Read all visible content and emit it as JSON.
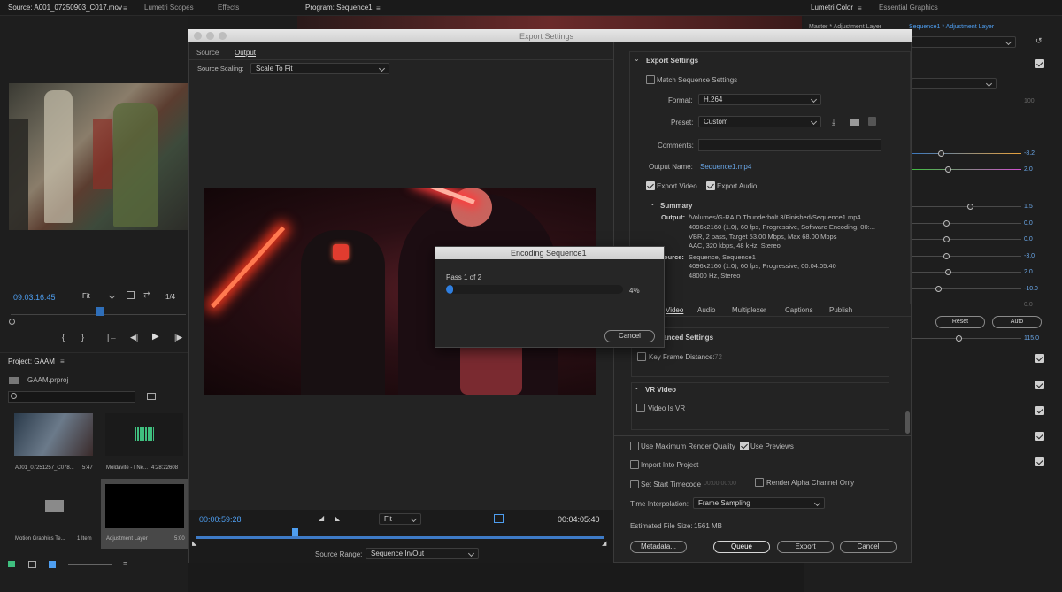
{
  "source_panel": {
    "tab_source": "Source: A001_07250903_C017.mov",
    "tab_scopes": "Lumetri Scopes",
    "tab_effects": "Effects",
    "timecode": "09:03:16:45",
    "fit": "Fit",
    "fraction": "1/4"
  },
  "program_panel": {
    "tab": "Program: Sequence1"
  },
  "lumetri": {
    "tab_color": "Lumetri Color",
    "tab_graphics": "Essential Graphics",
    "master_label": "Master * Adjustment Layer",
    "sequence_label": "Sequence1 * Adjustment Layer",
    "values": [
      "100",
      "-8.2",
      "2.0",
      "1.5",
      "0.0",
      "0.0",
      "-3.0",
      "2.0",
      "-10.0",
      "0.0",
      "115.0"
    ],
    "reset_label": "Reset",
    "auto_label": "Auto"
  },
  "project": {
    "title": "Project: GAAM",
    "file": "GAAM.prproj",
    "items": [
      {
        "name": "A001_07251257_C078...",
        "meta": "5:47"
      },
      {
        "name": "Moldavite - I Ne...",
        "meta": "4:28:22608"
      },
      {
        "name": "Motion Graphics Te...",
        "meta": "1 Item"
      },
      {
        "name": "Adjustment Layer",
        "meta": "5:00"
      }
    ]
  },
  "export_dialog": {
    "title": "Export Settings",
    "tab_source": "Source",
    "tab_output": "Output",
    "source_scaling_label": "Source Scaling:",
    "source_scaling_value": "Scale To Fit",
    "current_time": "00:00:59:28",
    "fit": "Fit",
    "duration": "00:04:05:40",
    "source_range_label": "Source Range:",
    "source_range_value": "Sequence In/Out",
    "section_export": "Export Settings",
    "match_sequence": "Match Sequence Settings",
    "format_label": "Format:",
    "format_value": "H.264",
    "preset_label": "Preset:",
    "preset_value": "Custom",
    "comments_label": "Comments:",
    "output_name_label": "Output Name:",
    "output_name_value": "Sequence1.mp4",
    "export_video": "Export Video",
    "export_audio": "Export Audio",
    "summary_title": "Summary",
    "summary_output_label": "Output:",
    "summary_output_lines": [
      "/Volumes/G-RAID Thunderbolt 3/Finished/Sequence1.mp4",
      "4096x2160 (1.0), 60 fps, Progressive, Software Encoding, 00:...",
      "VBR, 2 pass, Target 53.00 Mbps, Max 68.00 Mbps",
      "AAC, 320 kbps, 48 kHz, Stereo"
    ],
    "summary_source_label": "Source:",
    "summary_source_lines": [
      "Sequence, Sequence1",
      "4096x2160 (1.0), 60 fps, Progressive, 00:04:05:40",
      "48000 Hz, Stereo"
    ],
    "tabs": [
      "Video",
      "Audio",
      "Multiplexer",
      "Captions",
      "Publish"
    ],
    "advanced_settings": "Advanced Settings",
    "key_frame_distance": "Key Frame Distance:",
    "key_frame_value": "72",
    "vr_video_title": "VR Video",
    "video_is_vr": "Video Is VR",
    "max_render_quality": "Use Maximum Render Quality",
    "use_previews": "Use Previews",
    "import_into_project": "Import Into Project",
    "set_start_timecode": "Set Start Timecode",
    "start_timecode_value": "00:00:00:00",
    "render_alpha": "Render Alpha Channel Only",
    "time_interp_label": "Time Interpolation:",
    "time_interp_value": "Frame Sampling",
    "file_size_label": "Estimated File Size:",
    "file_size_value": "1561 MB",
    "metadata_btn": "Metadata...",
    "queue_btn": "Queue",
    "export_btn": "Export",
    "cancel_btn": "Cancel"
  },
  "encoding": {
    "title": "Encoding Sequence1",
    "pass": "Pass 1 of 2",
    "percent": "4%",
    "progress": 0.04,
    "cancel": "Cancel"
  }
}
